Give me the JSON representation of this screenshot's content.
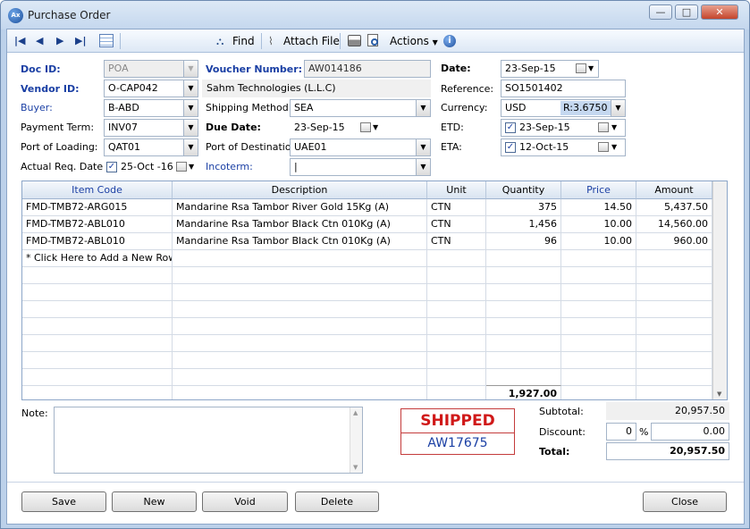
{
  "window": {
    "title": "Purchase Order",
    "app_icon": "Ax",
    "minimize": "—",
    "restore": "□",
    "close": "✕"
  },
  "toolbar": {
    "find": "Find",
    "attach": "Attach File",
    "actions": "Actions"
  },
  "form": {
    "doc_id_label": "Doc ID:",
    "doc_id": "POA",
    "voucher_label": "Voucher Number:",
    "voucher": "AW014186",
    "date_label": "Date:",
    "date": "23-Sep-15",
    "vendor_label": "Vendor ID:",
    "vendor": "O-CAP042",
    "vendor_name": "Sahm Technologies (L.L.C)",
    "reference_label": "Reference:",
    "reference": "SO1501402",
    "buyer_label": "Buyer:",
    "buyer": "B-ABD",
    "shipping_label": "Shipping Method:",
    "shipping": "SEA",
    "currency_label": "Currency:",
    "currency": "USD",
    "rate": "R:3.6750",
    "payterm_label": "Payment Term:",
    "payterm": "INV07",
    "duedate_label": "Due Date:",
    "duedate": "23-Sep-15",
    "etd_label": "ETD:",
    "etd": "23-Sep-15",
    "pol_label": "Port of Loading:",
    "pol": "QAT01",
    "pod_label": "Port of Destination:",
    "pod": "UAE01",
    "eta_label": "ETA:",
    "eta": "12-Oct-15",
    "actreq_label": "Actual Req. Date:",
    "actreq": "25-Oct -16",
    "incoterm_label": "Incoterm:",
    "incoterm": "|"
  },
  "grid": {
    "headers": [
      "Item Code",
      "Description",
      "Unit",
      "Quantity",
      "Price",
      "Amount"
    ],
    "rows": [
      [
        "FMD-TMB72-ARG015",
        "Mandarine Rsa Tambor River Gold 15Kg (A)",
        "CTN",
        "375",
        "14.50",
        "5,437.50"
      ],
      [
        "FMD-TMB72-ABL010",
        "Mandarine Rsa Tambor Black Ctn 010Kg (A)",
        "CTN",
        "1,456",
        "10.00",
        "14,560.00"
      ],
      [
        "FMD-TMB72-ABL010",
        "Mandarine Rsa Tambor Black Ctn 010Kg (A)",
        "CTN",
        "96",
        "10.00",
        "960.00"
      ]
    ],
    "add_row": "* Click Here to Add a New Row",
    "qty_total": "1,927.00"
  },
  "note_label": "Note:",
  "stamp": {
    "status": "SHIPPED",
    "number": "AW17675"
  },
  "summary": {
    "subtotal_label": "Subtotal:",
    "subtotal": "20,957.50",
    "discount_label": "Discount:",
    "discount_pct": "0",
    "pct_sign": "%",
    "discount_amt": "0.00",
    "total_label": "Total:",
    "total": "20,957.50"
  },
  "buttons": {
    "save": "Save",
    "new": "New",
    "void": "Void",
    "delete": "Delete",
    "close": "Close"
  }
}
